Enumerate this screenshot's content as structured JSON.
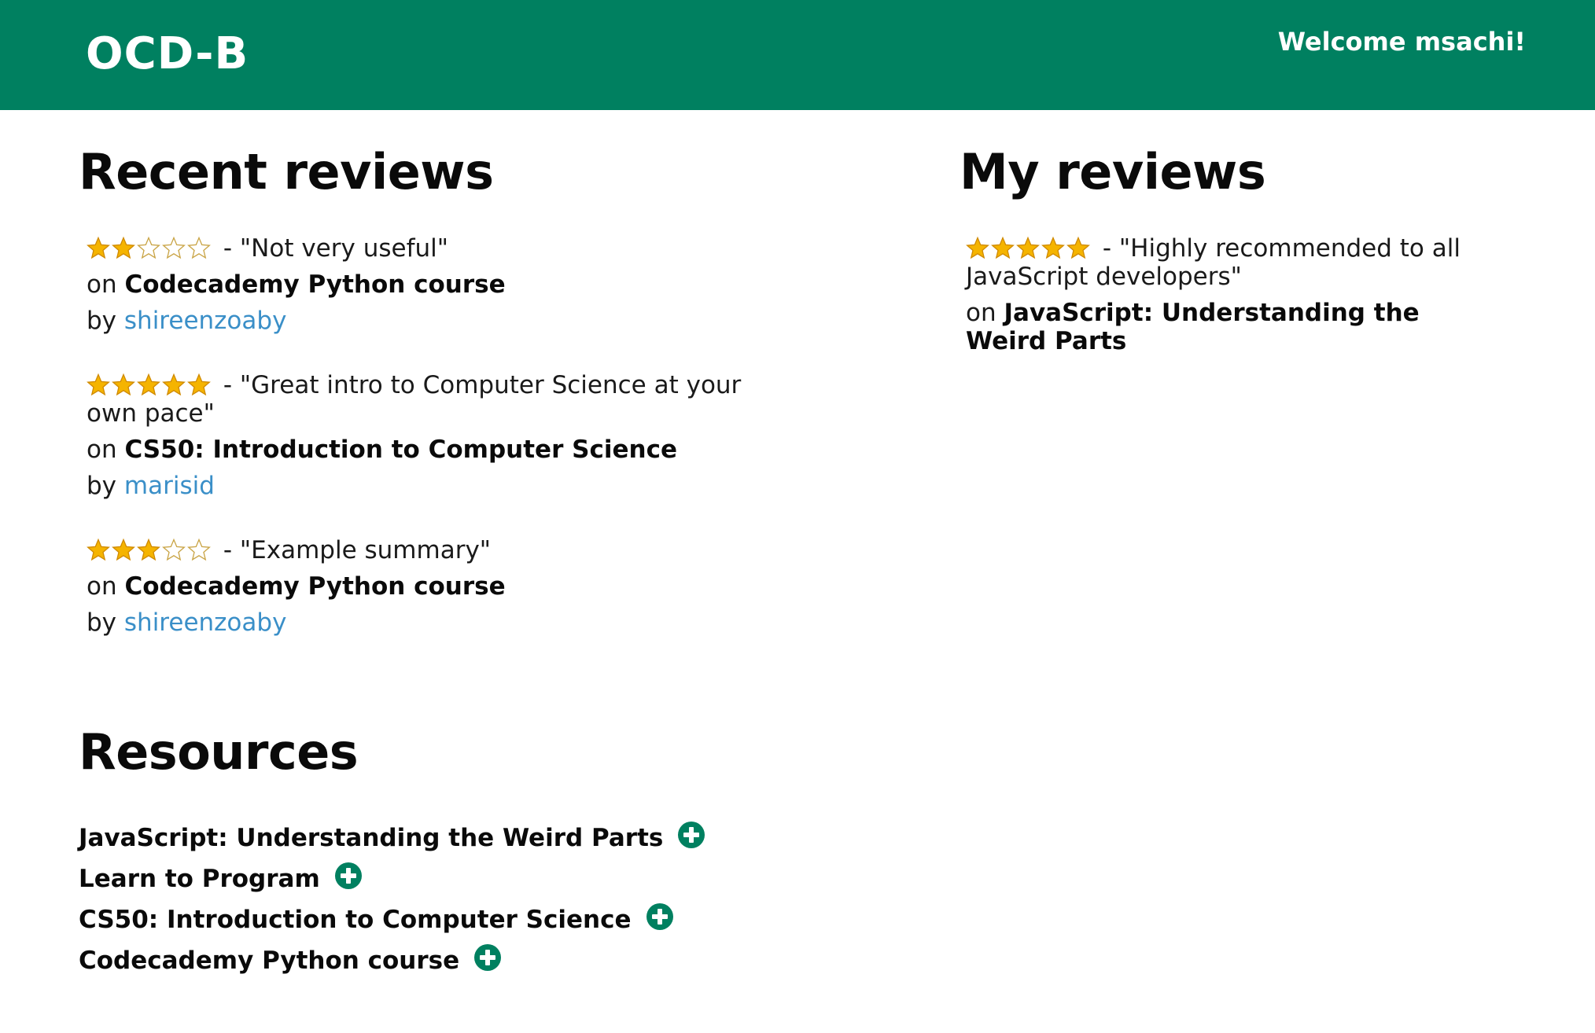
{
  "header": {
    "brand": "OCD-B",
    "welcome": "Welcome msachi!",
    "background_color": "#008060"
  },
  "recent_reviews": {
    "title": "Recent reviews",
    "items": [
      {
        "rating": 2,
        "max_rating": 5,
        "summary": "\"Not very useful\"",
        "on_prefix": "on",
        "course": "Codecademy Python course",
        "by_prefix": "by",
        "author": "shireenzoaby"
      },
      {
        "rating": 5,
        "max_rating": 5,
        "summary": "\"Great intro to Computer Science at your own pace\"",
        "on_prefix": "on",
        "course": "CS50: Introduction to Computer Science",
        "by_prefix": "by",
        "author": "marisid"
      },
      {
        "rating": 3,
        "max_rating": 5,
        "summary": "\"Example summary\"",
        "on_prefix": "on",
        "course": "Codecademy Python course",
        "by_prefix": "by",
        "author": "shireenzoaby"
      }
    ]
  },
  "my_reviews": {
    "title": "My reviews",
    "items": [
      {
        "rating": 5,
        "max_rating": 5,
        "summary": "\"Highly recommended to all JavaScript developers\"",
        "on_prefix": "on",
        "course": "JavaScript: Understanding the Weird Parts"
      }
    ]
  },
  "resources": {
    "title": "Resources",
    "items": [
      {
        "label": "JavaScript: Understanding the Weird Parts",
        "action_icon": "plus-circle-icon"
      },
      {
        "label": "Learn to Program",
        "action_icon": "plus-circle-icon"
      },
      {
        "label": "CS50: Introduction to Computer Science",
        "action_icon": "plus-circle-icon"
      },
      {
        "label": "Codecademy Python course",
        "action_icon": "plus-circle-icon"
      }
    ]
  },
  "colors": {
    "star_filled": "#F5B400",
    "star_outline": "#C9A445",
    "link": "#3A8FC8",
    "accent": "#008060"
  }
}
